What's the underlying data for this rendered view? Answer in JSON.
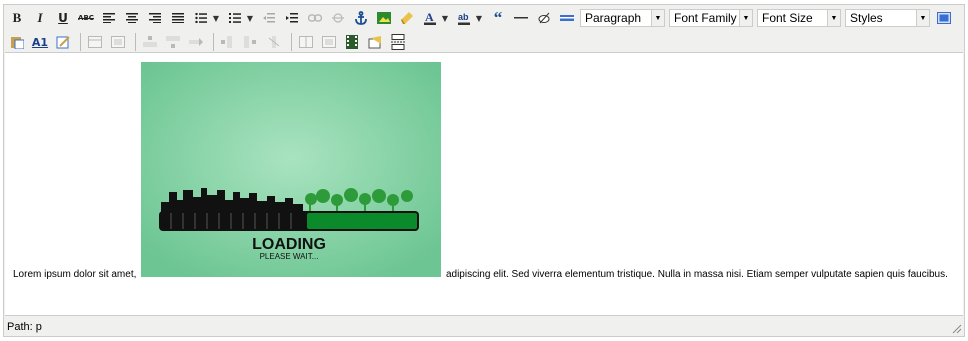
{
  "toolbar": {
    "row1_buttons": [
      {
        "name": "bold-button",
        "glyph": "B"
      },
      {
        "name": "italic-button",
        "glyph": "I"
      },
      {
        "name": "underline-button",
        "glyph": "U"
      },
      {
        "name": "strikethrough-button",
        "glyph": "ABC"
      }
    ],
    "block_format": {
      "selected": "Paragraph"
    },
    "font_family": {
      "selected": "Font Family"
    },
    "font_size": {
      "selected": "Font Size"
    },
    "styles": {
      "selected": "Styles"
    }
  },
  "content": {
    "text_before": "Lorem ipsum dolor sit amet,",
    "text_after": "adipiscing elit. Sed viverra elementum tristique. Nulla in massa nisi. Etiam semper vulputate sapien quis faucibus.",
    "image": {
      "heading": "LOADING",
      "subheading": "PLEASE WAIT...",
      "bg_color": "#74c99a",
      "bar_color": "#0a8a2a"
    }
  },
  "statusbar": {
    "path_label": "Path:",
    "path_value": "p"
  }
}
